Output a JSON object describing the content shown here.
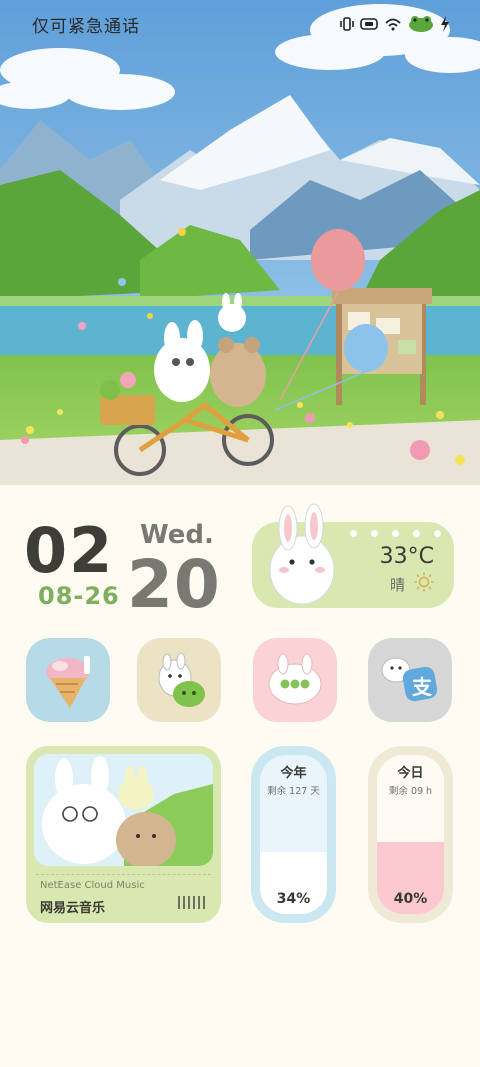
{
  "status_bar": {
    "carrier_text": "仅可紧急通话",
    "icons": [
      "vibrate-icon",
      "battery-saver-icon",
      "wifi-icon",
      "frog-battery-icon",
      "charging-icon"
    ]
  },
  "clock": {
    "hour": "02",
    "weekday": "Wed.",
    "day": "20",
    "date": "08-26"
  },
  "weather": {
    "temperature": "33°C",
    "condition": "晴",
    "icon": "sun-icon"
  },
  "apps": [
    {
      "name": "icecream-app",
      "icon": "icecream-icon",
      "bg": "#b6dbe6"
    },
    {
      "name": "wechat-app",
      "icon": "chat-bubble-icon",
      "bg": "#ece2c4"
    },
    {
      "name": "messages-app",
      "icon": "bunny-message-icon",
      "bg": "#fbd3d6"
    },
    {
      "name": "alipay-app",
      "icon": "alipay-icon",
      "bg": "#d7d7d8"
    }
  ],
  "music": {
    "subtitle": "NetEase Cloud Music",
    "title": "网易云音乐"
  },
  "year_progress": {
    "title": "今年",
    "remaining": "剩余 127 天",
    "percent": "34%",
    "fraction": 0.34
  },
  "day_progress": {
    "title": "今日",
    "remaining": "剩余 09 h",
    "percent": "40%",
    "fraction": 0.4
  },
  "colors": {
    "page_bg": "#fdfbf2",
    "widget_green": "#d9e7b1",
    "year_frame": "#cbe7f2",
    "day_frame": "#f0e9d6",
    "date_green": "#7fae5d"
  }
}
